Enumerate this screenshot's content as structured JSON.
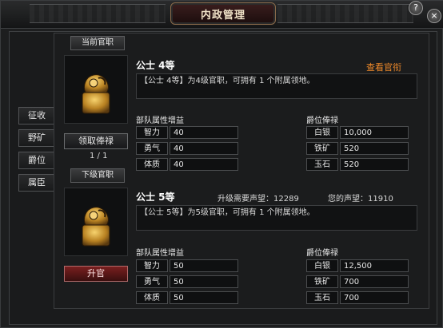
{
  "window": {
    "title": "内政管理",
    "help_label": "?",
    "close_label": "×"
  },
  "tabs": [
    {
      "label": "征收"
    },
    {
      "label": "野矿"
    },
    {
      "label": "爵位"
    },
    {
      "label": "属臣"
    }
  ],
  "current": {
    "section_label": "当前官职",
    "rank_name": "公士 4等",
    "link_label": "查看官衔",
    "description": "【公士 4等】为4级官职，可拥有 1 个附属领地。",
    "collect_button": "领取俸禄",
    "page_indicator": "1 / 1",
    "attr_header": "部队属性增益",
    "attrs": [
      {
        "name": "智力",
        "value": "40"
      },
      {
        "name": "勇气",
        "value": "40"
      },
      {
        "name": "体质",
        "value": "40"
      }
    ],
    "salary_header": "爵位俸禄",
    "salary": [
      {
        "name": "白银",
        "value": "10,000"
      },
      {
        "name": "铁矿",
        "value": "520"
      },
      {
        "name": "玉石",
        "value": "520"
      }
    ]
  },
  "next": {
    "section_label": "下级官职",
    "rank_name": "公士 5等",
    "required_label": "升级需要声望：12289",
    "your_label": "您的声望：11910",
    "description": "【公士 5等】为5级官职，可拥有 1 个附属领地。",
    "upgrade_button": "升官",
    "attr_header": "部队属性增益",
    "attrs": [
      {
        "name": "智力",
        "value": "50"
      },
      {
        "name": "勇气",
        "value": "50"
      },
      {
        "name": "体质",
        "value": "50"
      }
    ],
    "salary_header": "爵位俸禄",
    "salary": [
      {
        "name": "白银",
        "value": "12,500"
      },
      {
        "name": "铁矿",
        "value": "700"
      },
      {
        "name": "玉石",
        "value": "700"
      }
    ]
  }
}
